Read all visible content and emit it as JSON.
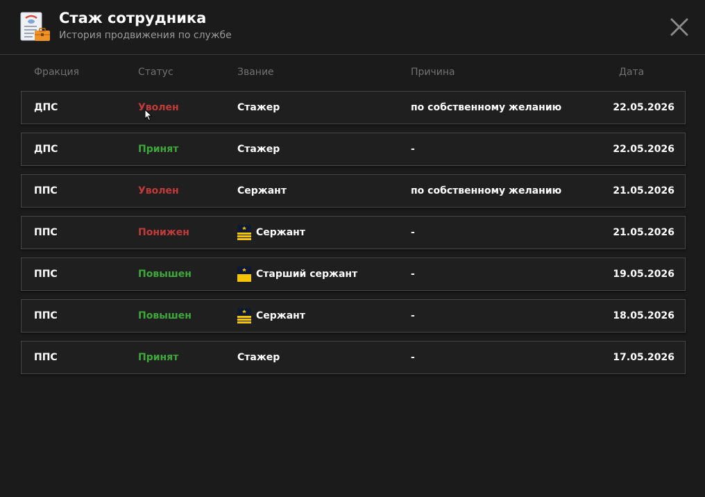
{
  "header": {
    "title": "Стаж сотрудника",
    "subtitle": "История продвижения по службе",
    "icon": "document-briefcase-icon",
    "close_icon": "close-icon"
  },
  "columns": [
    "Фракция",
    "Статус",
    "Звание",
    "Причина",
    "Дата"
  ],
  "colors": {
    "background": "#1b1b1b",
    "row_border": "#474747",
    "status_negative": "#c23a3a",
    "status_positive": "#3ea83a",
    "rank_badge": "#f5c400"
  },
  "rows": [
    {
      "faction": "ДПС",
      "status": "Уволен",
      "status_tone": "negative",
      "rank": "Стажер",
      "rank_badge": "",
      "reason": "по собственному желанию",
      "date": "22.05.2026"
    },
    {
      "faction": "ДПС",
      "status": "Принят",
      "status_tone": "positive",
      "rank": "Стажер",
      "rank_badge": "",
      "reason": "-",
      "date": "22.05.2026"
    },
    {
      "faction": "ППС",
      "status": "Уволен",
      "status_tone": "negative",
      "rank": "Сержант",
      "rank_badge": "",
      "reason": "по собственному желанию",
      "date": "21.05.2026"
    },
    {
      "faction": "ППС",
      "status": "Понижен",
      "status_tone": "negative",
      "rank": "Сержант",
      "rank_badge": "sergeant-icon",
      "reason": "-",
      "date": "21.05.2026"
    },
    {
      "faction": "ППС",
      "status": "Повышен",
      "status_tone": "positive",
      "rank": "Старший сержант",
      "rank_badge": "senior-sergeant-icon",
      "reason": "-",
      "date": "19.05.2026"
    },
    {
      "faction": "ППС",
      "status": "Повышен",
      "status_tone": "positive",
      "rank": "Сержант",
      "rank_badge": "sergeant-icon",
      "reason": "-",
      "date": "18.05.2026"
    },
    {
      "faction": "ППС",
      "status": "Принят",
      "status_tone": "positive",
      "rank": "Стажер",
      "rank_badge": "",
      "reason": "-",
      "date": "17.05.2026"
    }
  ]
}
